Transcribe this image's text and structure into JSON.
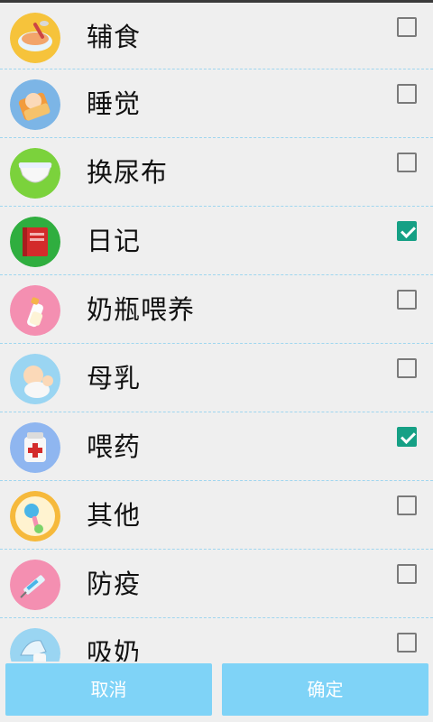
{
  "items": [
    {
      "label": "辅食",
      "icon": "baby-food-bowl-icon",
      "checked": false
    },
    {
      "label": "睡觉",
      "icon": "sleeping-baby-icon",
      "checked": false
    },
    {
      "label": "换尿布",
      "icon": "diaper-icon",
      "checked": false
    },
    {
      "label": "日记",
      "icon": "diary-book-icon",
      "checked": true
    },
    {
      "label": "奶瓶喂养",
      "icon": "baby-bottle-icon",
      "checked": false
    },
    {
      "label": "母乳",
      "icon": "breastfeeding-baby-icon",
      "checked": false
    },
    {
      "label": "喂药",
      "icon": "medicine-bottle-icon",
      "checked": true
    },
    {
      "label": "其他",
      "icon": "rattle-icon",
      "checked": false
    },
    {
      "label": "防疫",
      "icon": "vaccine-syringe-icon",
      "checked": false
    },
    {
      "label": "吸奶",
      "icon": "breast-pump-icon",
      "checked": false
    }
  ],
  "buttons": {
    "cancel": "取消",
    "ok": "确定"
  },
  "colors": {
    "accent": "#16a085",
    "button": "#7fd3f7",
    "divider": "#9fd6ef"
  }
}
